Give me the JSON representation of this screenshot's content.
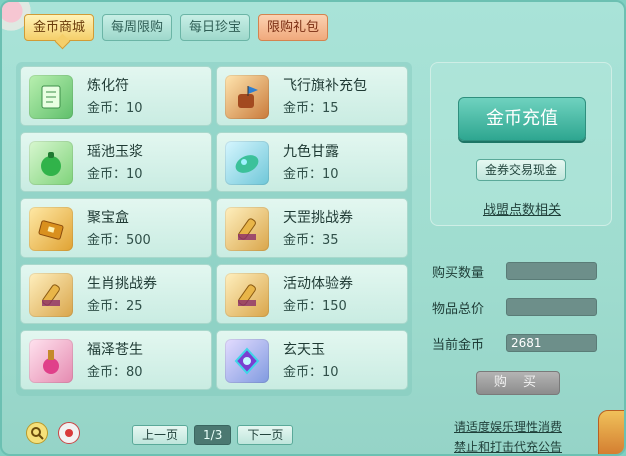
{
  "tabs": [
    {
      "label": "金币商城",
      "active": true
    },
    {
      "label": "每周限购",
      "active": false
    },
    {
      "label": "每日珍宝",
      "active": false
    },
    {
      "label": "限购礼包",
      "active": false
    }
  ],
  "items": [
    {
      "name": "炼化符",
      "price": "金币：10",
      "icon": "talisman-icon"
    },
    {
      "name": "飞行旗补充包",
      "price": "金币：15",
      "icon": "flag-pack-icon"
    },
    {
      "name": "瑶池玉浆",
      "price": "金币：10",
      "icon": "jade-gourd-icon"
    },
    {
      "name": "九色甘露",
      "price": "金币：10",
      "icon": "dew-leaf-icon"
    },
    {
      "name": "聚宝盒",
      "price": "金币：500",
      "icon": "treasure-box-icon"
    },
    {
      "name": "天罡挑战券",
      "price": "金币：35",
      "icon": "scroll-icon"
    },
    {
      "name": "生肖挑战券",
      "price": "金币：25",
      "icon": "scroll-icon"
    },
    {
      "name": "活动体验券",
      "price": "金币：150",
      "icon": "scroll-icon"
    },
    {
      "name": "福泽苍生",
      "price": "金币：80",
      "icon": "potion-bottle-icon"
    },
    {
      "name": "玄天玉",
      "price": "金币：10",
      "icon": "gem-icon"
    }
  ],
  "side": {
    "recharge_label": "金币充值",
    "exchange_label": "金券交易现金",
    "alliance_label": "战盟点数相关"
  },
  "form": {
    "quantity_label": "购买数量",
    "quantity_value": "",
    "total_label": "物品总价",
    "total_value": "",
    "current_label": "当前金币",
    "current_value": "2681",
    "buy_label": "购 买"
  },
  "pager": {
    "prev_label": "上一页",
    "page_indicator": "1/3",
    "next_label": "下一页"
  },
  "notices": {
    "line1": "请适度娱乐理性消费",
    "line2": "禁止和打击代充公告"
  },
  "colors": {
    "panel_bg": "#9fdccf",
    "active_tab": "#f5cf6a",
    "special_tab": "#f0a97c",
    "recharge_button": "#2ea690",
    "buy_button_disabled": "#9a9a9a"
  }
}
